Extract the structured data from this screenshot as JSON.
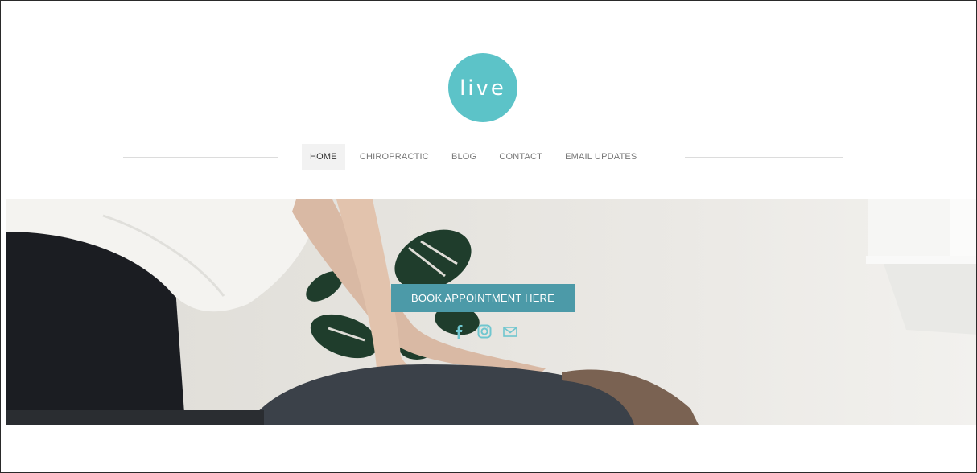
{
  "brand": {
    "logo_text": "live",
    "logo_color": "#5cc3c8"
  },
  "nav": {
    "items": [
      {
        "label": "HOME",
        "active": true
      },
      {
        "label": "CHIROPRACTIC",
        "active": false
      },
      {
        "label": "BLOG",
        "active": false
      },
      {
        "label": "CONTACT",
        "active": false
      },
      {
        "label": "EMAIL UPDATES",
        "active": false
      }
    ]
  },
  "hero": {
    "cta_label": "BOOK APPOINTMENT HERE",
    "cta_color": "#4c9aa8",
    "social_icons": [
      "facebook-icon",
      "instagram-icon",
      "email-icon"
    ],
    "social_color": "#6fc6cf"
  }
}
